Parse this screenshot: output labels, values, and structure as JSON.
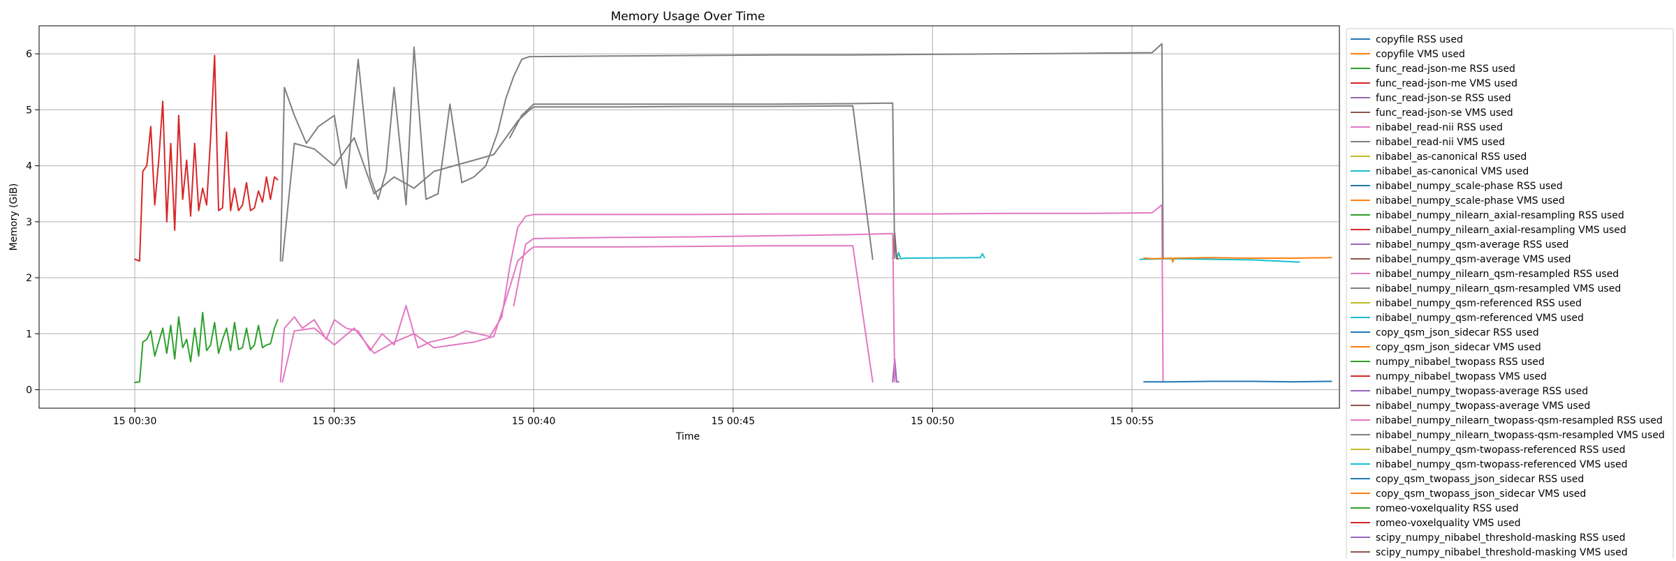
{
  "chart_data": {
    "type": "line",
    "title": "Memory Usage Over Time",
    "xlabel": "Time",
    "ylabel": "Memory (GiB)",
    "x_unit": "minutes past 00:30 on day 15",
    "xlim": [
      -2.4,
      30.2
    ],
    "ylim": [
      -0.33,
      6.5
    ],
    "grid": true,
    "legend_position": "outside-right",
    "x_ticks": [
      {
        "value": 0,
        "label": "15 00:30"
      },
      {
        "value": 5,
        "label": "15 00:35"
      },
      {
        "value": 10,
        "label": "15 00:40"
      },
      {
        "value": 15,
        "label": "15 00:45"
      },
      {
        "value": 20,
        "label": "15 00:50"
      },
      {
        "value": 25,
        "label": "15 00:55"
      }
    ],
    "y_ticks": [
      {
        "value": 0,
        "label": "0"
      },
      {
        "value": 1,
        "label": "1"
      },
      {
        "value": 2,
        "label": "2"
      },
      {
        "value": 3,
        "label": "3"
      },
      {
        "value": 4,
        "label": "4"
      },
      {
        "value": 5,
        "label": "5"
      },
      {
        "value": 6,
        "label": "6"
      }
    ],
    "series": [
      {
        "name": "copyfile RSS used",
        "color": "#1f77b4",
        "x": [],
        "y": []
      },
      {
        "name": "copyfile VMS used",
        "color": "#ff7f0e",
        "x": [],
        "y": []
      },
      {
        "name": "func_read-json-me RSS used",
        "color": "#2ca02c",
        "x": [
          0,
          0.12,
          0.2,
          0.3,
          0.4,
          0.5,
          0.6,
          0.7,
          0.8,
          0.9,
          1.0,
          1.1,
          1.2,
          1.3,
          1.4,
          1.5,
          1.6,
          1.7,
          1.8,
          1.9,
          2.0,
          2.1,
          2.2,
          2.3,
          2.4,
          2.5,
          2.6,
          2.7,
          2.8,
          2.9,
          3.0,
          3.1,
          3.2,
          3.3,
          3.4,
          3.5,
          3.58
        ],
        "y": [
          0.13,
          0.14,
          0.85,
          0.9,
          1.05,
          0.6,
          0.85,
          1.1,
          0.65,
          1.15,
          0.55,
          1.3,
          0.75,
          0.9,
          0.5,
          1.1,
          0.6,
          1.38,
          0.7,
          0.8,
          1.2,
          0.65,
          0.9,
          1.1,
          0.7,
          1.2,
          0.72,
          0.75,
          1.1,
          0.72,
          0.8,
          1.15,
          0.75,
          0.8,
          0.82,
          1.1,
          1.25
        ]
      },
      {
        "name": "func_read-json-me VMS used",
        "color": "#d62728",
        "x": [
          0,
          0.12,
          0.2,
          0.3,
          0.4,
          0.5,
          0.6,
          0.7,
          0.8,
          0.9,
          1.0,
          1.1,
          1.2,
          1.3,
          1.4,
          1.5,
          1.6,
          1.7,
          1.8,
          1.9,
          2.0,
          2.1,
          2.2,
          2.3,
          2.4,
          2.5,
          2.6,
          2.7,
          2.8,
          2.9,
          3.0,
          3.1,
          3.2,
          3.3,
          3.4,
          3.5,
          3.58
        ],
        "y": [
          2.33,
          2.3,
          3.9,
          4.0,
          4.7,
          3.3,
          4.1,
          5.15,
          3.0,
          4.4,
          2.85,
          4.9,
          3.4,
          4.1,
          3.1,
          4.4,
          3.2,
          3.6,
          3.3,
          4.5,
          5.97,
          3.2,
          3.25,
          4.6,
          3.2,
          3.6,
          3.2,
          3.3,
          3.7,
          3.2,
          3.25,
          3.55,
          3.35,
          3.8,
          3.4,
          3.8,
          3.75
        ]
      },
      {
        "name": "func_read-json-se RSS used",
        "color": "#9467bd",
        "x": [],
        "y": []
      },
      {
        "name": "func_read-json-se VMS used",
        "color": "#8c564b",
        "x": [],
        "y": []
      },
      {
        "name": "nibabel_read-nii RSS used",
        "color": "#e377c2",
        "x": [
          3.65,
          3.75,
          4.0,
          4.2,
          4.5,
          4.8,
          5.0,
          5.3,
          5.6,
          5.9,
          6.2,
          6.5,
          6.8,
          7.1,
          7.4,
          7.7,
          8.0,
          8.3,
          8.6,
          8.9,
          9.2,
          9.4,
          9.6,
          9.8,
          10.0,
          12.0,
          14.0,
          16.0,
          18.0,
          20.0,
          22.0,
          24.0,
          25.5,
          25.75,
          25.78
        ],
        "y": [
          0.14,
          1.1,
          1.3,
          1.1,
          1.25,
          0.9,
          1.25,
          1.1,
          1.05,
          0.7,
          1.0,
          0.8,
          1.5,
          0.75,
          0.85,
          0.9,
          0.95,
          1.05,
          1.0,
          0.95,
          1.3,
          2.2,
          2.9,
          3.1,
          3.13,
          3.13,
          3.13,
          3.14,
          3.14,
          3.14,
          3.15,
          3.15,
          3.16,
          3.3,
          0.15
        ]
      },
      {
        "name": "nibabel_read-nii VMS used",
        "color": "#7f7f7f",
        "x": [
          3.65,
          3.75,
          4.0,
          4.3,
          4.6,
          5.0,
          5.3,
          5.6,
          5.9,
          6.1,
          6.3,
          6.5,
          6.8,
          7.0,
          7.3,
          7.6,
          7.9,
          8.2,
          8.5,
          8.8,
          9.1,
          9.3,
          9.5,
          9.7,
          9.9,
          10.0,
          12.0,
          14.0,
          16.0,
          18.0,
          20.0,
          22.0,
          24.0,
          25.5,
          25.75,
          25.78
        ],
        "y": [
          2.3,
          5.4,
          4.9,
          4.4,
          4.7,
          4.9,
          3.6,
          5.9,
          3.8,
          3.4,
          3.9,
          5.4,
          3.3,
          6.12,
          3.4,
          3.5,
          5.1,
          3.7,
          3.8,
          4.0,
          4.6,
          5.2,
          5.6,
          5.9,
          5.95,
          5.95,
          5.96,
          5.97,
          5.98,
          5.98,
          5.99,
          6.0,
          6.01,
          6.02,
          6.18,
          2.35
        ]
      },
      {
        "name": "nibabel_as-canonical RSS used",
        "color": "#bcbd22",
        "x": [],
        "y": []
      },
      {
        "name": "nibabel_as-canonical VMS used",
        "color": "#17becf",
        "x": [],
        "y": []
      },
      {
        "name": "nibabel_numpy_scale-phase RSS used",
        "color": "#1f77b4",
        "x": [],
        "y": []
      },
      {
        "name": "nibabel_numpy_scale-phase VMS used",
        "color": "#ff7f0e",
        "x": [],
        "y": []
      },
      {
        "name": "nibabel_numpy_nilearn_axial-resampling RSS used",
        "color": "#2ca02c",
        "x": [],
        "y": []
      },
      {
        "name": "nibabel_numpy_nilearn_axial-resampling VMS used",
        "color": "#d62728",
        "x": [],
        "y": []
      },
      {
        "name": "nibabel_numpy_qsm-average RSS used",
        "color": "#9467bd",
        "x": [],
        "y": []
      },
      {
        "name": "nibabel_numpy_qsm-average VMS used",
        "color": "#8c564b",
        "x": [],
        "y": []
      },
      {
        "name": "nibabel_numpy_nilearn_qsm-resampled RSS used",
        "color": "#e377c2",
        "x": [
          3.7,
          4.0,
          4.5,
          5.0,
          5.5,
          6.0,
          6.5,
          7.0,
          7.5,
          8.0,
          8.5,
          9.0,
          9.3,
          9.6,
          9.9,
          10.0,
          12.0,
          14.0,
          16.0,
          18.0,
          18.5
        ],
        "y": [
          0.14,
          1.05,
          1.1,
          0.8,
          1.1,
          0.65,
          0.85,
          1.0,
          0.75,
          0.8,
          0.85,
          0.95,
          1.6,
          2.3,
          2.5,
          2.55,
          2.55,
          2.56,
          2.57,
          2.57,
          0.14
        ]
      },
      {
        "name": "nibabel_numpy_nilearn_qsm-resampled VMS used",
        "color": "#7f7f7f",
        "x": [
          3.7,
          4.0,
          4.5,
          5.0,
          5.5,
          6.0,
          6.5,
          7.0,
          7.5,
          8.0,
          8.5,
          9.0,
          9.3,
          9.6,
          9.9,
          10.0,
          12.0,
          14.0,
          16.0,
          18.0,
          18.5
        ],
        "y": [
          2.3,
          4.4,
          4.3,
          4.0,
          4.5,
          3.5,
          3.8,
          3.6,
          3.9,
          4.0,
          4.1,
          4.2,
          4.5,
          4.8,
          5.0,
          5.05,
          5.05,
          5.06,
          5.06,
          5.07,
          2.33
        ]
      },
      {
        "name": "nibabel_numpy_qsm-referenced RSS used",
        "color": "#bcbd22",
        "x": [],
        "y": []
      },
      {
        "name": "nibabel_numpy_qsm-referenced VMS used",
        "color": "#17becf",
        "x": [
          19.1,
          19.15,
          19.2,
          19.3,
          21.2,
          21.25,
          21.3
        ],
        "y": [
          2.34,
          2.45,
          2.34,
          2.35,
          2.36,
          2.43,
          2.36
        ]
      },
      {
        "name": "copy_qsm_json_sidecar RSS used",
        "color": "#1f77b4",
        "x": [],
        "y": []
      },
      {
        "name": "copy_qsm_json_sidecar VMS used",
        "color": "#ff7f0e",
        "x": [],
        "y": []
      },
      {
        "name": "numpy_nibabel_twopass RSS used",
        "color": "#2ca02c",
        "x": [],
        "y": []
      },
      {
        "name": "numpy_nibabel_twopass VMS used",
        "color": "#d62728",
        "x": [],
        "y": []
      },
      {
        "name": "nibabel_numpy_twopass-average RSS used",
        "color": "#9467bd",
        "x": [
          19.0,
          19.05,
          19.1,
          19.15
        ],
        "y": [
          0.14,
          0.55,
          0.14,
          0.14
        ]
      },
      {
        "name": "nibabel_numpy_twopass-average VMS used",
        "color": "#8c564b",
        "x": [
          19.0,
          19.05,
          19.1,
          19.15
        ],
        "y": [
          2.34,
          2.8,
          2.34,
          2.34
        ]
      },
      {
        "name": "nibabel_numpy_nilearn_twopass-qsm-resampled RSS used",
        "color": "#e377c2",
        "x": [
          9.5,
          9.8,
          10.0,
          12.0,
          14.0,
          16.0,
          18.0,
          19.0,
          19.05
        ],
        "y": [
          1.5,
          2.6,
          2.7,
          2.72,
          2.73,
          2.75,
          2.77,
          2.79,
          0.14
        ]
      },
      {
        "name": "nibabel_numpy_nilearn_twopass-qsm-resampled VMS used",
        "color": "#7f7f7f",
        "x": [
          9.4,
          9.7,
          10.0,
          12.0,
          14.0,
          16.0,
          18.0,
          19.0,
          19.05
        ],
        "y": [
          4.5,
          4.9,
          5.1,
          5.1,
          5.1,
          5.1,
          5.11,
          5.12,
          2.35
        ]
      },
      {
        "name": "nibabel_numpy_qsm-twopass-referenced RSS used",
        "color": "#bcbd22",
        "x": [],
        "y": []
      },
      {
        "name": "nibabel_numpy_qsm-twopass-referenced VMS used",
        "color": "#17becf",
        "x": [
          25.2,
          26.0,
          27.0,
          28.0,
          29.2
        ],
        "y": [
          2.33,
          2.34,
          2.33,
          2.32,
          2.28
        ]
      },
      {
        "name": "copy_qsm_twopass_json_sidecar RSS used",
        "color": "#1f77b4",
        "x": [
          25.3,
          26.0,
          27.0,
          28.0,
          29.0,
          30.0
        ],
        "y": [
          0.14,
          0.14,
          0.15,
          0.15,
          0.14,
          0.15
        ]
      },
      {
        "name": "copy_qsm_twopass_json_sidecar VMS used",
        "color": "#ff7f0e",
        "x": [
          25.3,
          25.5,
          26.0,
          26.02,
          26.05,
          27.0,
          28.0,
          29.0,
          30.0
        ],
        "y": [
          2.35,
          2.34,
          2.35,
          2.28,
          2.35,
          2.36,
          2.35,
          2.35,
          2.36
        ]
      },
      {
        "name": "romeo-voxelquality RSS used",
        "color": "#2ca02c",
        "x": [],
        "y": []
      },
      {
        "name": "romeo-voxelquality VMS used",
        "color": "#d62728",
        "x": [],
        "y": []
      },
      {
        "name": "scipy_numpy_nibabel_threshold-masking RSS used",
        "color": "#9467bd",
        "x": [],
        "y": []
      },
      {
        "name": "scipy_numpy_nibabel_threshold-masking VMS used",
        "color": "#8c564b",
        "x": [],
        "y": []
      }
    ]
  }
}
